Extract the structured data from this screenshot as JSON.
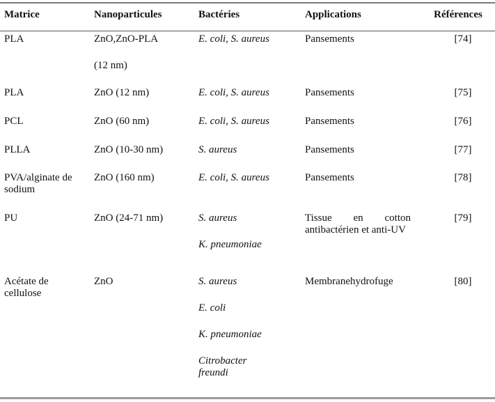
{
  "table": {
    "headers": [
      "Matrice",
      "Nanoparticules",
      "Bactéries",
      "Applications",
      "Références"
    ],
    "rows": [
      {
        "matrice": "PLA",
        "nanoparticules": [
          "ZnO,ZnO-PLA",
          "(12 nm)"
        ],
        "bacteries": [
          "E. coli, S. aureus"
        ],
        "applications": "Pansements",
        "references": "[74]"
      },
      {
        "matrice": "PLA",
        "nanoparticules": [
          "ZnO (12 nm)"
        ],
        "bacteries": [
          "E. coli, S. aureus"
        ],
        "applications": "Pansements",
        "references": "[75]"
      },
      {
        "matrice": "PCL",
        "nanoparticules": [
          "ZnO (60 nm)"
        ],
        "bacteries": [
          "E. coli, S. aureus"
        ],
        "applications": "Pansements",
        "references": "[76]"
      },
      {
        "matrice": "PLLA",
        "nanoparticules": [
          "ZnO (10-30 nm)"
        ],
        "bacteries": [
          "S. aureus"
        ],
        "applications": "Pansements",
        "references": "[77]"
      },
      {
        "matrice": "PVA/alginate de sodium",
        "nanoparticules": [
          "ZnO (160 nm)"
        ],
        "bacteries": [
          "E. coli, S. aureus"
        ],
        "applications": "Pansements",
        "references": "[78]"
      },
      {
        "matrice": "PU",
        "nanoparticules": [
          "ZnO (24-71 nm)"
        ],
        "bacteries": [
          "S. aureus",
          "K. pneumoniae"
        ],
        "applications": "Tissue en cotton antibactérien et anti-UV",
        "references": "[79]"
      },
      {
        "matrice": "Acétate de cellulose",
        "nanoparticules": [
          "ZnO"
        ],
        "bacteries": [
          "S. aureus",
          "E. coli",
          "K. pneumoniae",
          "Citrobacter freundi"
        ],
        "applications": "Membranehydrofuge",
        "references": "[80]"
      }
    ]
  }
}
